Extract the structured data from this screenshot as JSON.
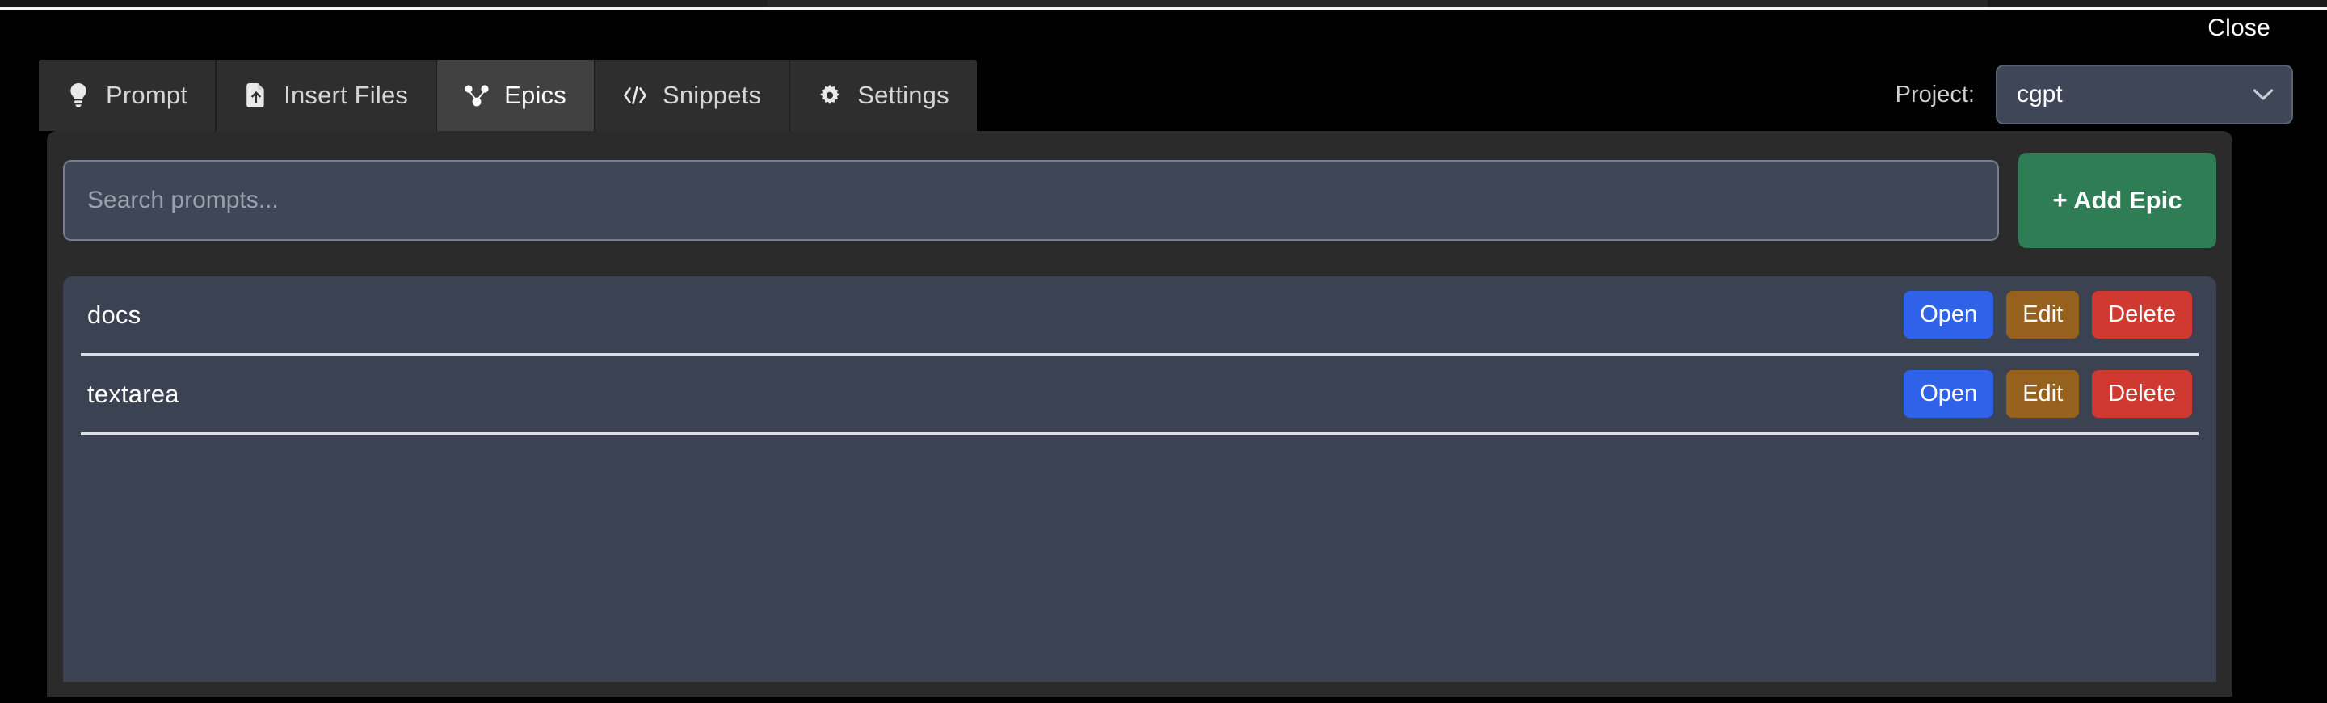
{
  "window": {
    "close_label": "Close"
  },
  "header": {
    "tabs": [
      {
        "id": "prompt",
        "label": "Prompt",
        "icon": "lightbulb-icon",
        "active": false
      },
      {
        "id": "insert-files",
        "label": "Insert Files",
        "icon": "file-upload-icon",
        "active": false
      },
      {
        "id": "epics",
        "label": "Epics",
        "icon": "sitemap-icon",
        "active": true
      },
      {
        "id": "snippets",
        "label": "Snippets",
        "icon": "code-icon",
        "active": false
      },
      {
        "id": "settings",
        "label": "Settings",
        "icon": "gear-icon",
        "active": false
      }
    ],
    "project": {
      "label": "Project:",
      "selected": "cgpt",
      "options": [
        "cgpt"
      ],
      "chevron_icon": "chevron-down-icon"
    }
  },
  "toolbar": {
    "search_placeholder": "Search prompts...",
    "search_value": "",
    "add_epic_label": "+ Add Epic"
  },
  "epics": {
    "row_action_labels": {
      "open": "Open",
      "edit": "Edit",
      "delete": "Delete"
    },
    "items": [
      {
        "name": "docs"
      },
      {
        "name": "textarea"
      }
    ]
  },
  "colors": {
    "page_background": "#000000",
    "panel_background": "#2b2b2b",
    "list_background": "#3b4252",
    "tab_inactive": "#2e2e2e",
    "tab_active": "#414141",
    "field_background": "#3f4657",
    "add_button": "#2e7d55",
    "open_button": "#2f62e8",
    "edit_button": "#96601d",
    "delete_button": "#d0392f",
    "divider": "#dcdee3"
  }
}
